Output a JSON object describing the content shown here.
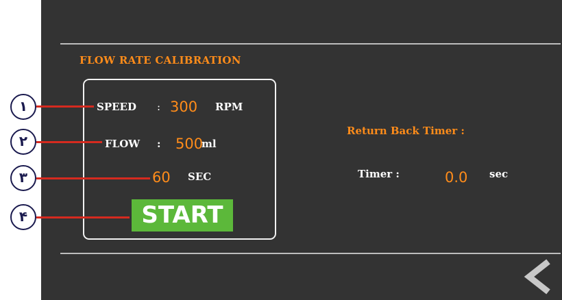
{
  "calibration": {
    "title": "FLOW RATE CALIBRATION",
    "speed": {
      "label": "SPEED",
      "sep": ":",
      "value": "300",
      "unit": "RPM"
    },
    "flow": {
      "label": "FLOW",
      "sep": ":",
      "value": "500",
      "unit": "ml"
    },
    "duration": {
      "value": "60",
      "unit": "SEC"
    },
    "start_label": "START"
  },
  "timer_panel": {
    "heading": "Return Back Timer :",
    "label": "Timer :",
    "value": "0.0",
    "unit": "sec"
  },
  "callouts": [
    "١",
    "٢",
    "٣",
    "۴"
  ],
  "nav": {
    "back_icon": "chevron-left-icon"
  },
  "colors": {
    "screen_bg": "#333333",
    "accent": "#ff8c1a",
    "start_button": "#5cb83a",
    "callout_line": "#d62a1f",
    "callout_border": "#1a1a4e"
  }
}
